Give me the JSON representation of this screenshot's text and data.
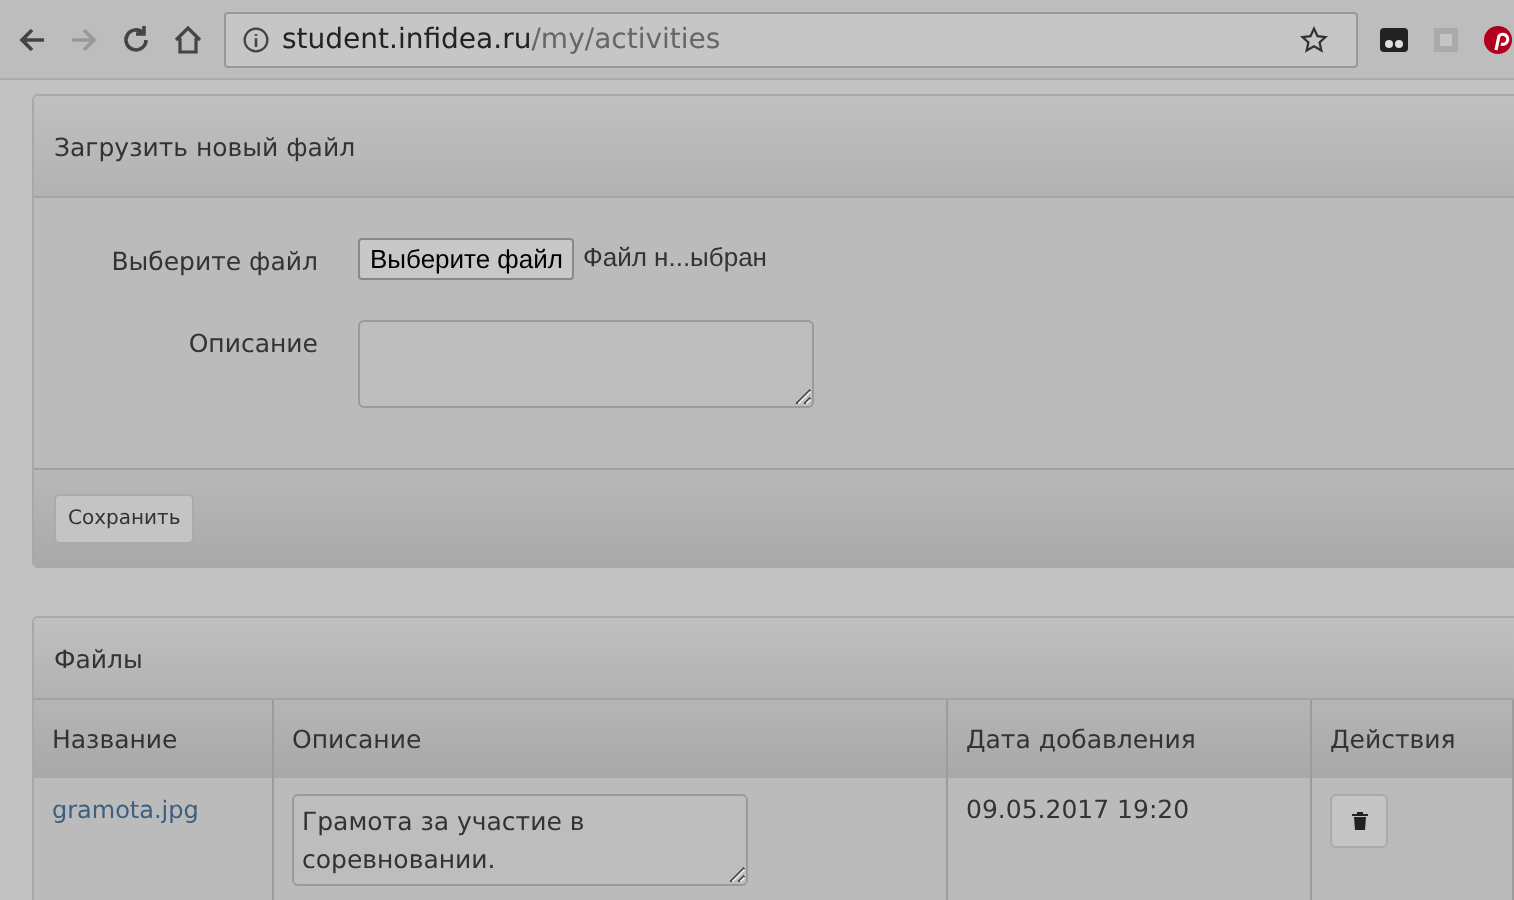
{
  "browser": {
    "url_host": "student.infidea.ru",
    "url_path": "/my/activities"
  },
  "upload_panel": {
    "title": "Загрузить новый файл",
    "file_label": "Выберите файл",
    "file_button": "Выберите файл",
    "file_status": "Файл н...ыбран",
    "description_label": "Описание",
    "save_button": "Сохранить"
  },
  "files_panel": {
    "title": "Файлы",
    "columns": [
      "Название",
      "Описание",
      "Дата добавления",
      "Действия"
    ],
    "rows": [
      {
        "name": "gramota.jpg",
        "description": "Грамота за участие в соревновании.",
        "date": "09.05.2017 19:20"
      }
    ]
  }
}
